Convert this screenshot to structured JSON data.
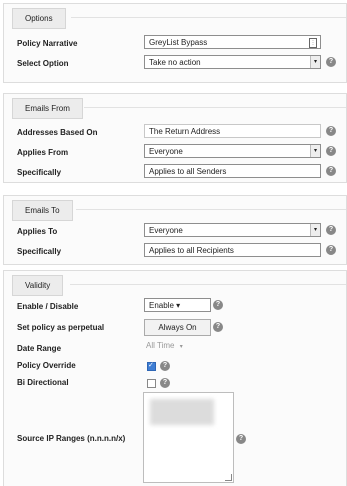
{
  "options": {
    "header": "Options",
    "policy_narrative_label": "Policy Narrative",
    "policy_narrative_value": "GreyList Bypass",
    "select_option_label": "Select Option",
    "select_option_value": "Take no action"
  },
  "emails_from": {
    "header": "Emails From",
    "addresses_label": "Addresses Based On",
    "addresses_value": "The Return Address",
    "applies_from_label": "Applies From",
    "applies_from_value": "Everyone",
    "specifically_label": "Specifically",
    "specifically_value": "Applies to all Senders"
  },
  "emails_to": {
    "header": "Emails To",
    "applies_to_label": "Applies To",
    "applies_to_value": "Everyone",
    "specifically_label": "Specifically",
    "specifically_value": "Applies to all Recipients"
  },
  "validity": {
    "header": "Validity",
    "enable_label": "Enable / Disable",
    "enable_value": "Enable",
    "perpetual_label": "Set policy as perpetual",
    "perpetual_button": "Always On",
    "date_range_label": "Date Range",
    "date_range_value": "All Time",
    "override_label": "Policy Override",
    "override_checked": true,
    "bidirectional_label": "Bi Directional",
    "bidirectional_checked": false,
    "source_ip_label": "Source IP Ranges (n.n.n.n/x)"
  },
  "icons": {
    "help": "help-icon",
    "dropdown": "chevron-down-icon"
  },
  "colors": {
    "accent_checkbox": "#3f7ed4",
    "help_icon": "#888888"
  }
}
